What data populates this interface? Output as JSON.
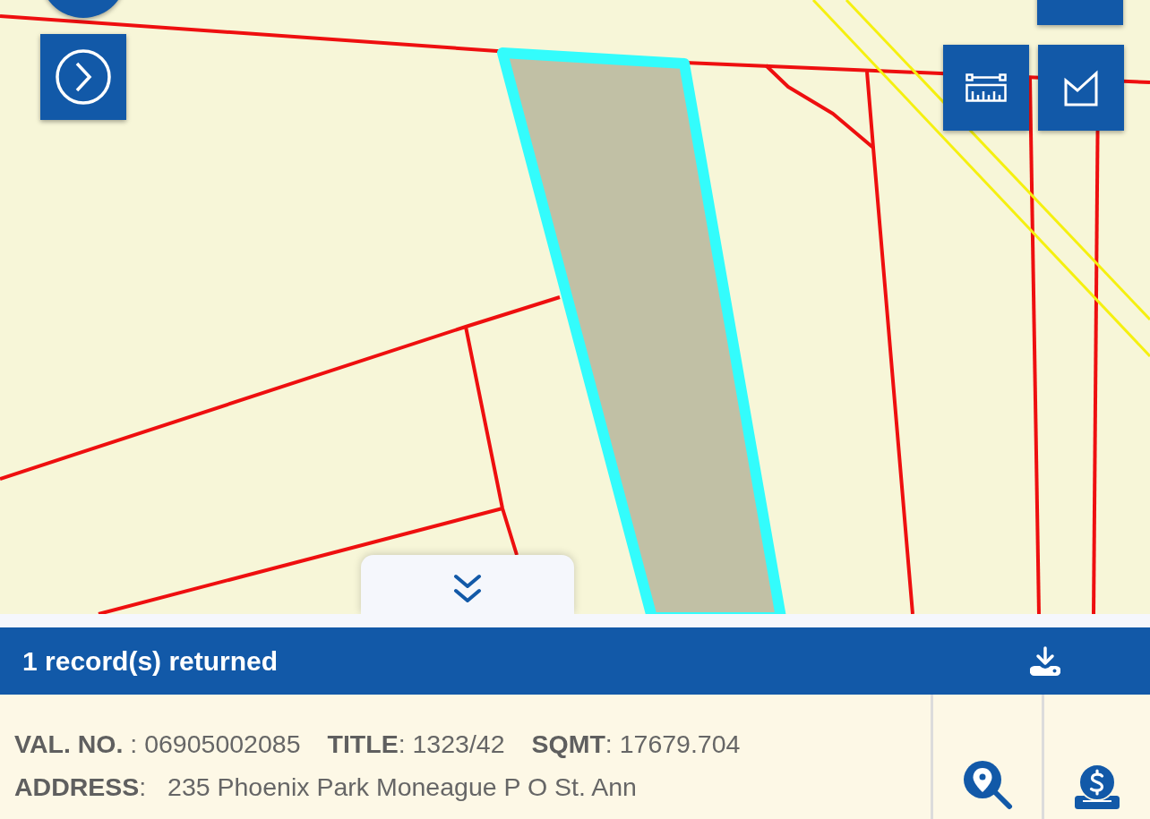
{
  "results_panel": {
    "header": "1 record(s) returned",
    "record": {
      "lines": [
        [
          "**VAL. NO.** : 06905002085",
          "**TITLE**: 1323/42",
          "**SQMT**: 17679.704"
        ],
        [
          "**ADDRESS**:   235 Phoenix Park Moneague P O St. Ann"
        ]
      ]
    }
  }
}
